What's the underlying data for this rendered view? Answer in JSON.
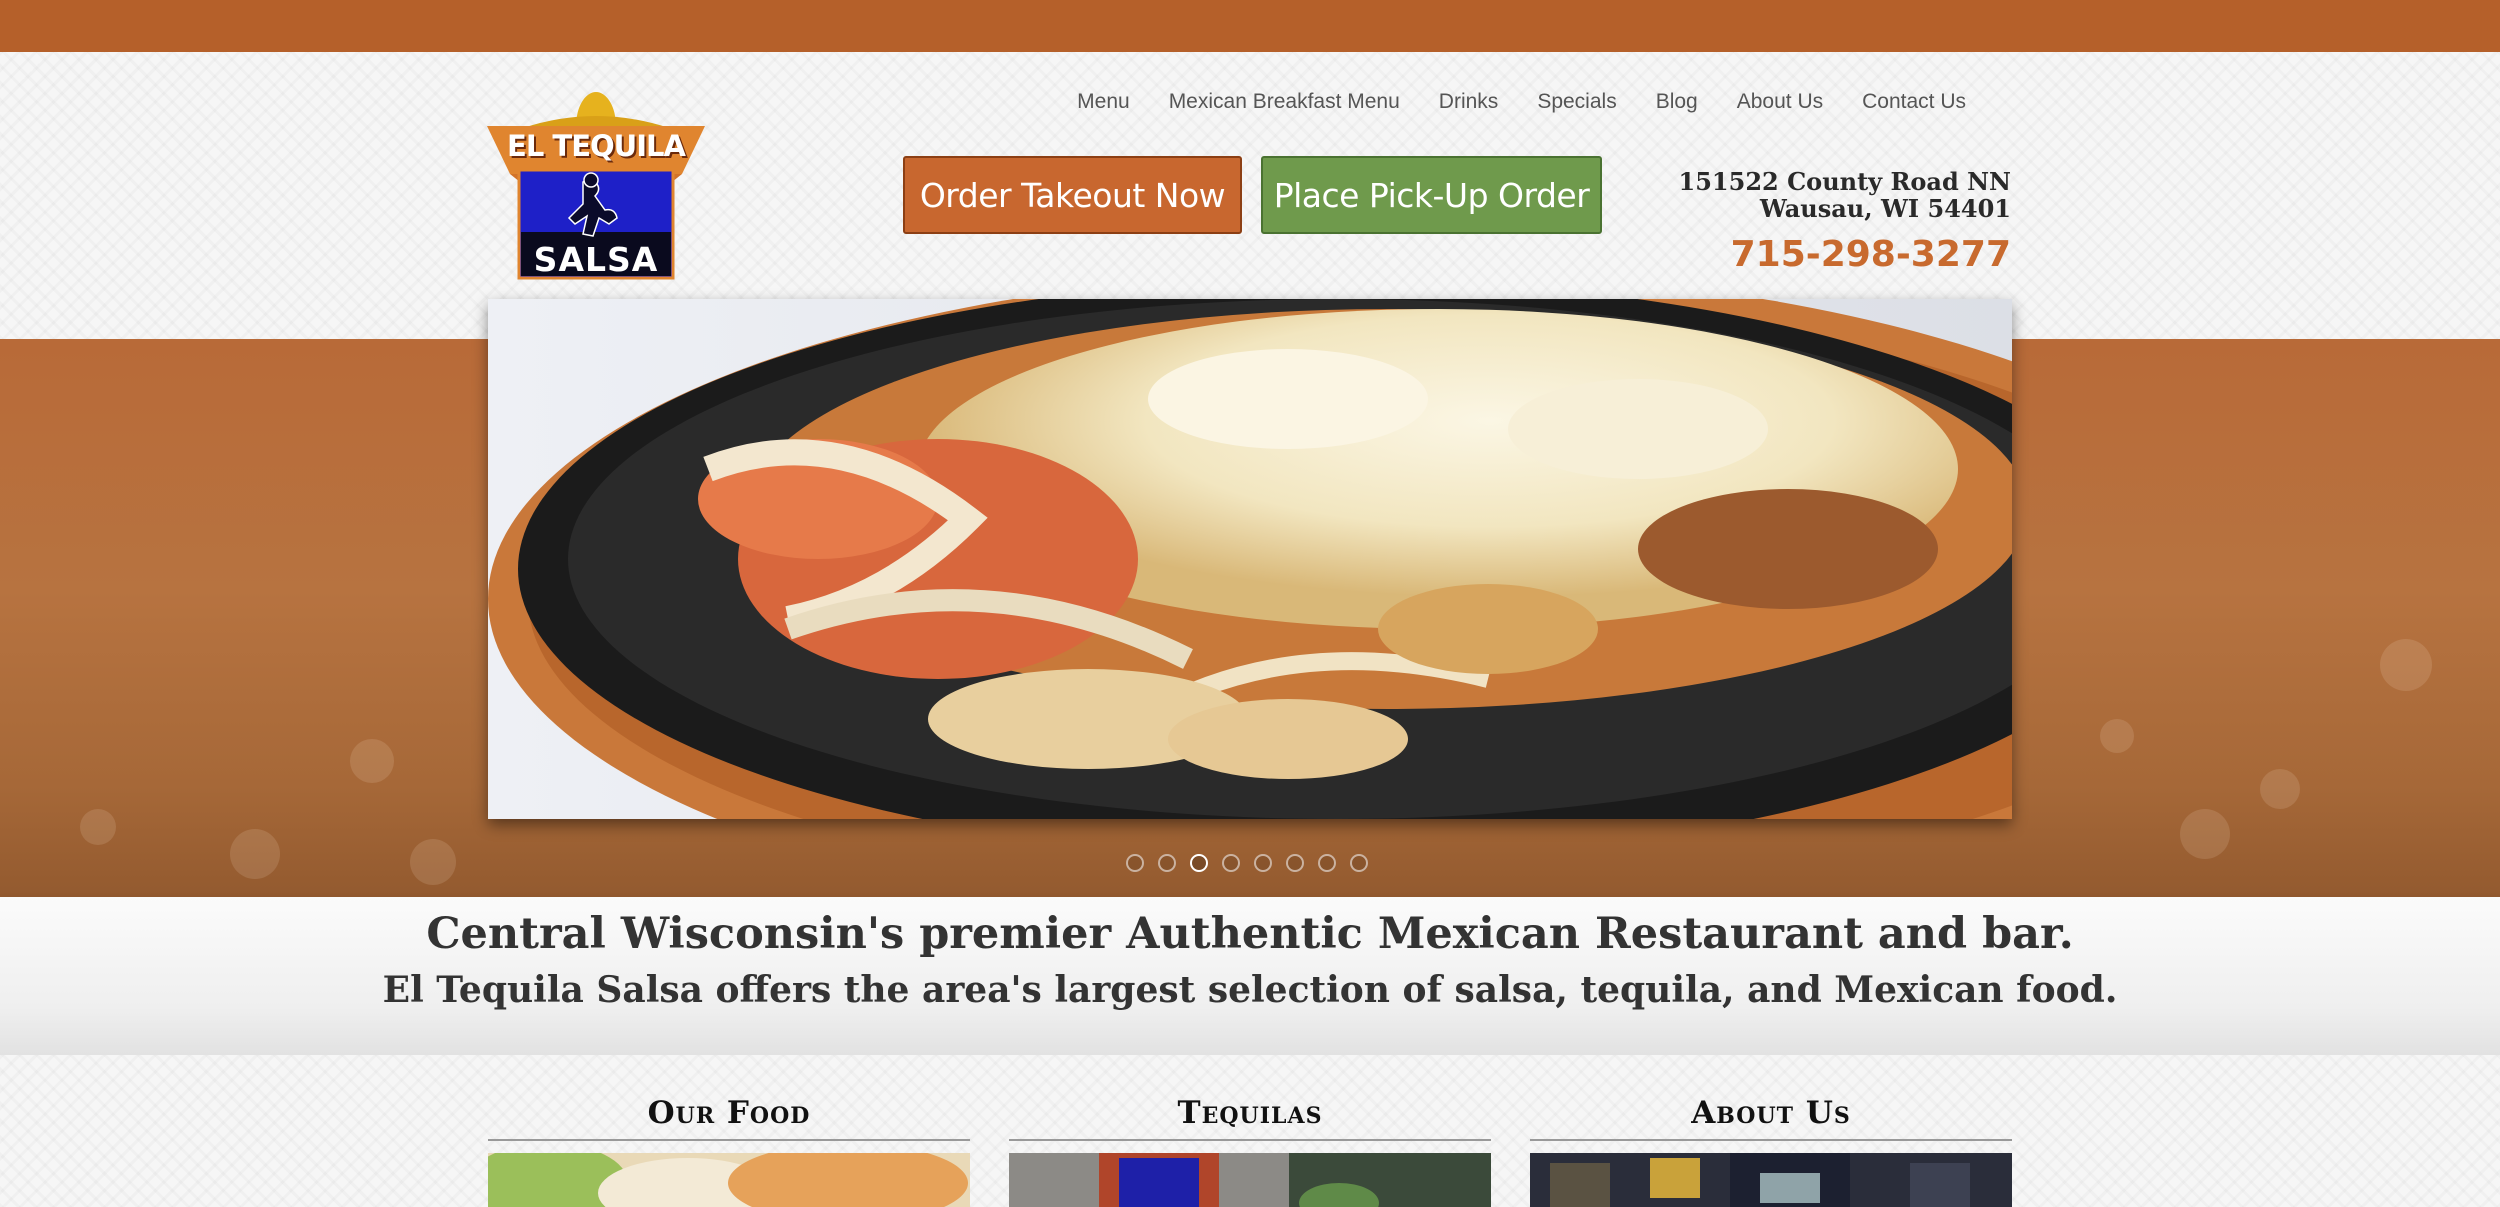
{
  "brand": {
    "logo_top": "EL TEQUILA",
    "logo_bottom": "SALSA"
  },
  "nav": {
    "items": [
      {
        "label": "Menu"
      },
      {
        "label": "Mexican Breakfast Menu"
      },
      {
        "label": "Drinks"
      },
      {
        "label": "Specials"
      },
      {
        "label": "Blog"
      },
      {
        "label": "About Us"
      },
      {
        "label": "Contact Us"
      }
    ]
  },
  "buttons": {
    "takeout": "Order Takeout Now",
    "pickup": "Place Pick-Up Order"
  },
  "contact": {
    "address_line1": "151522 County Road NN",
    "address_line2": "Wausau, WI 54401",
    "phone": "715-298-3277"
  },
  "slider": {
    "slide_count": 8,
    "active_slide": 3
  },
  "tagline": {
    "line1": "Central Wisconsin's premier Authentic Mexican Restaurant and bar.",
    "line2": "El Tequila Salsa offers the area's largest selection of salsa, tequila, and Mexican food."
  },
  "features": [
    {
      "title": "Our Food"
    },
    {
      "title": "Tequilas"
    },
    {
      "title": "About Us"
    }
  ],
  "colors": {
    "brand_orange": "#c8672f",
    "brand_green": "#6f9a4c",
    "top_bar": "#b5602a"
  }
}
